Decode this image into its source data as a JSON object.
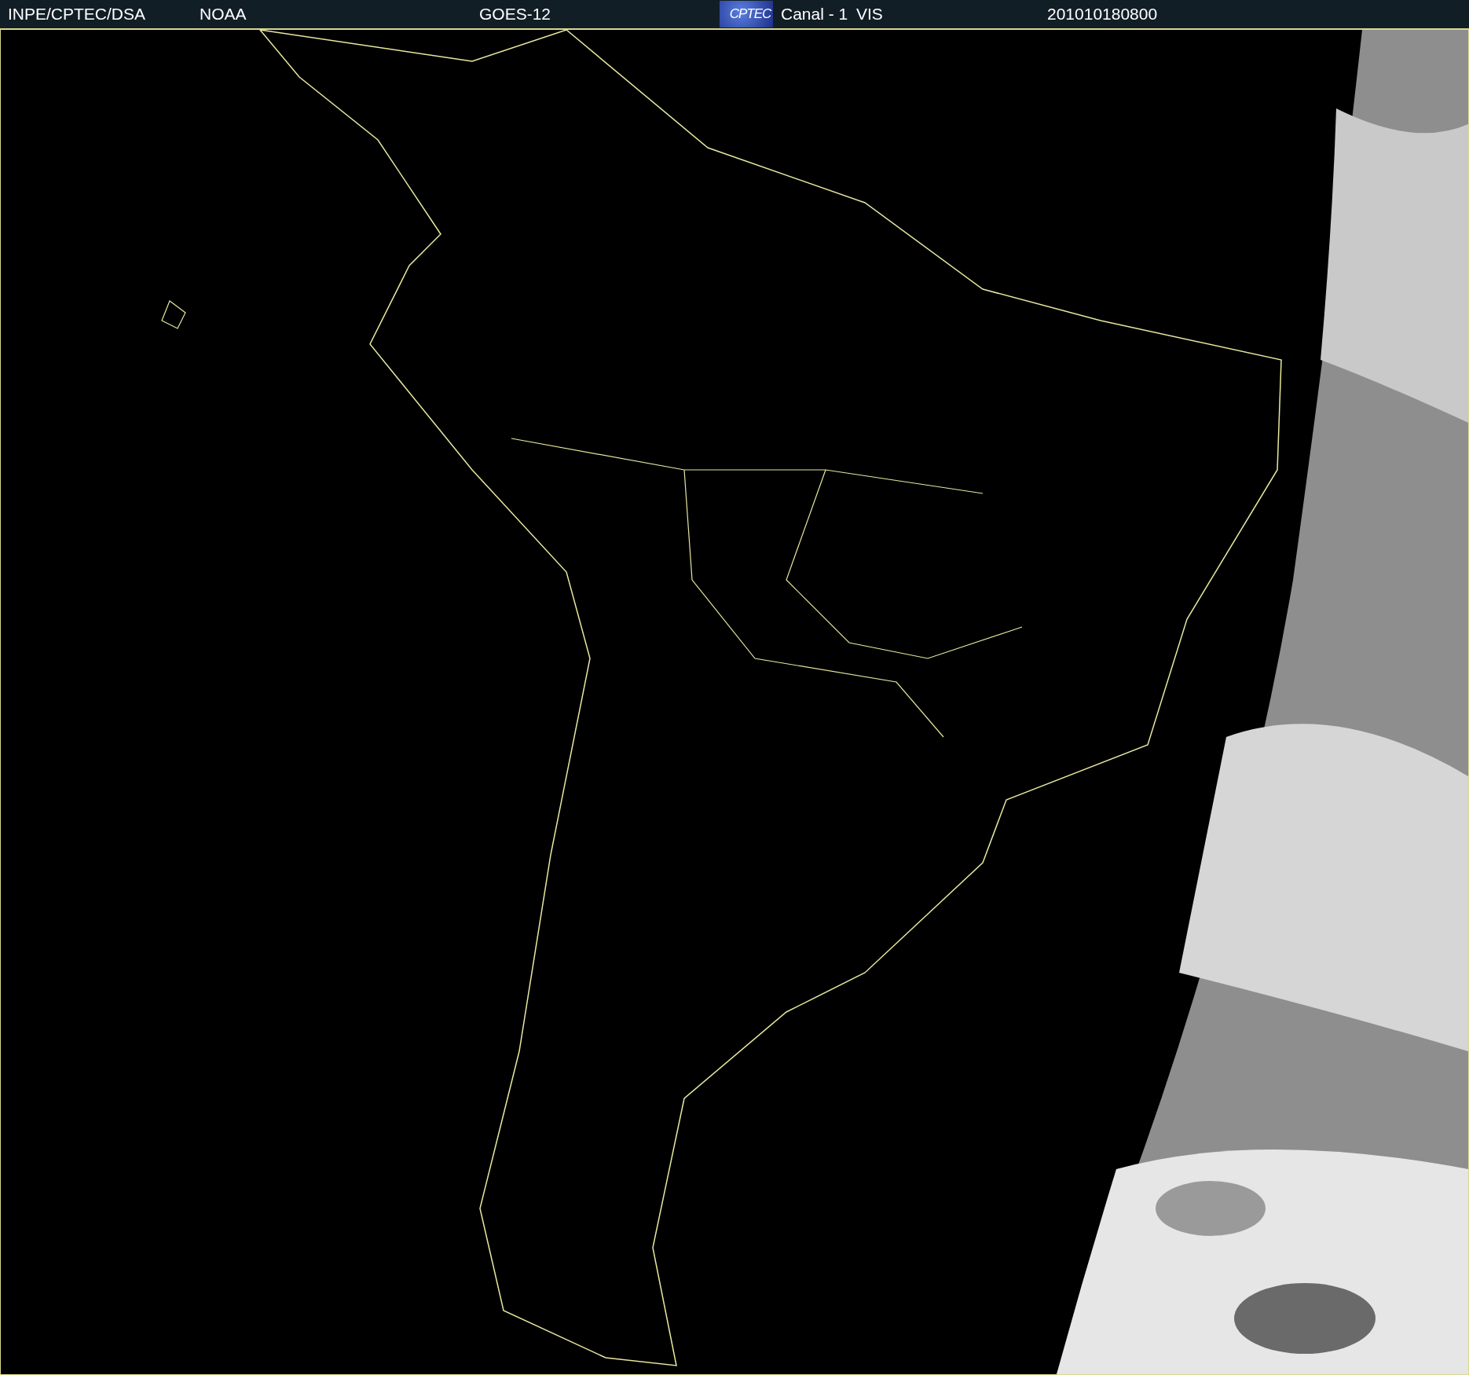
{
  "header": {
    "items": [
      {
        "kind": "text",
        "text": "INPE/CPTEC/DSA"
      },
      {
        "kind": "text",
        "text": "NOAA"
      },
      {
        "kind": "text",
        "text": "GOES-12"
      },
      {
        "kind": "logo",
        "text": "CPTEC"
      },
      {
        "kind": "text",
        "text": "Canal - 1"
      },
      {
        "kind": "text",
        "text": "VIS"
      },
      {
        "kind": "text",
        "text": "201010180800"
      }
    ]
  }
}
